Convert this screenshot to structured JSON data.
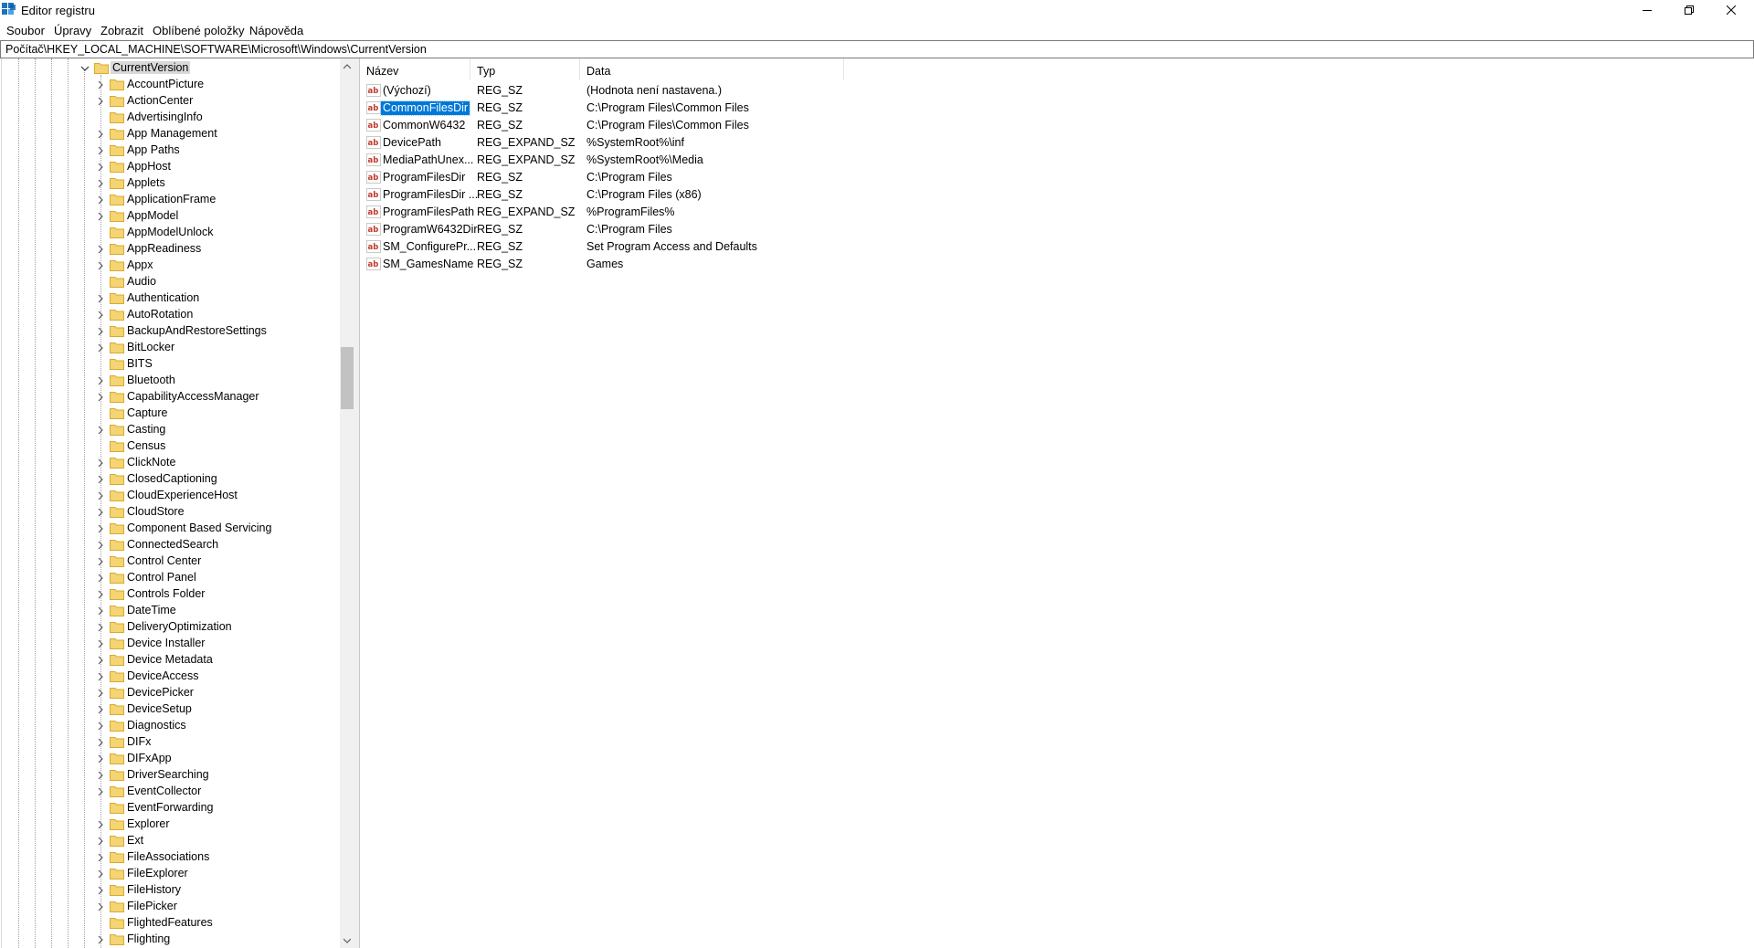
{
  "window": {
    "title": "Editor registru"
  },
  "menu": [
    "Soubor",
    "Úpravy",
    "Zobrazit",
    "Oblíbené položky",
    "Nápověda"
  ],
  "address": "Počítač\\HKEY_LOCAL_MACHINE\\SOFTWARE\\Microsoft\\Windows\\CurrentVersion",
  "tree": {
    "selected": "CurrentVersion",
    "children": [
      {
        "label": "AccountPicture",
        "expandable": true
      },
      {
        "label": "ActionCenter",
        "expandable": true
      },
      {
        "label": "AdvertisingInfo",
        "expandable": false
      },
      {
        "label": "App Management",
        "expandable": true
      },
      {
        "label": "App Paths",
        "expandable": true
      },
      {
        "label": "AppHost",
        "expandable": true
      },
      {
        "label": "Applets",
        "expandable": true
      },
      {
        "label": "ApplicationFrame",
        "expandable": true
      },
      {
        "label": "AppModel",
        "expandable": true
      },
      {
        "label": "AppModelUnlock",
        "expandable": false
      },
      {
        "label": "AppReadiness",
        "expandable": true
      },
      {
        "label": "Appx",
        "expandable": true
      },
      {
        "label": "Audio",
        "expandable": false
      },
      {
        "label": "Authentication",
        "expandable": true
      },
      {
        "label": "AutoRotation",
        "expandable": true
      },
      {
        "label": "BackupAndRestoreSettings",
        "expandable": true
      },
      {
        "label": "BitLocker",
        "expandable": true
      },
      {
        "label": "BITS",
        "expandable": false
      },
      {
        "label": "Bluetooth",
        "expandable": true
      },
      {
        "label": "CapabilityAccessManager",
        "expandable": true
      },
      {
        "label": "Capture",
        "expandable": false
      },
      {
        "label": "Casting",
        "expandable": true
      },
      {
        "label": "Census",
        "expandable": false
      },
      {
        "label": "ClickNote",
        "expandable": true
      },
      {
        "label": "ClosedCaptioning",
        "expandable": true
      },
      {
        "label": "CloudExperienceHost",
        "expandable": true
      },
      {
        "label": "CloudStore",
        "expandable": true
      },
      {
        "label": "Component Based Servicing",
        "expandable": true
      },
      {
        "label": "ConnectedSearch",
        "expandable": true
      },
      {
        "label": "Control Center",
        "expandable": true
      },
      {
        "label": "Control Panel",
        "expandable": true
      },
      {
        "label": "Controls Folder",
        "expandable": true
      },
      {
        "label": "DateTime",
        "expandable": true
      },
      {
        "label": "DeliveryOptimization",
        "expandable": true
      },
      {
        "label": "Device Installer",
        "expandable": true
      },
      {
        "label": "Device Metadata",
        "expandable": true
      },
      {
        "label": "DeviceAccess",
        "expandable": true
      },
      {
        "label": "DevicePicker",
        "expandable": true
      },
      {
        "label": "DeviceSetup",
        "expandable": true
      },
      {
        "label": "Diagnostics",
        "expandable": true
      },
      {
        "label": "DIFx",
        "expandable": true
      },
      {
        "label": "DIFxApp",
        "expandable": true
      },
      {
        "label": "DriverSearching",
        "expandable": true
      },
      {
        "label": "EventCollector",
        "expandable": true
      },
      {
        "label": "EventForwarding",
        "expandable": false
      },
      {
        "label": "Explorer",
        "expandable": true
      },
      {
        "label": "Ext",
        "expandable": true
      },
      {
        "label": "FileAssociations",
        "expandable": true
      },
      {
        "label": "FileExplorer",
        "expandable": true
      },
      {
        "label": "FileHistory",
        "expandable": true
      },
      {
        "label": "FilePicker",
        "expandable": true
      },
      {
        "label": "FlightedFeatures",
        "expandable": false
      },
      {
        "label": "Flighting",
        "expandable": true
      }
    ]
  },
  "list": {
    "columns": {
      "name": "Název",
      "type": "Typ",
      "data": "Data"
    },
    "selected": "CommonFilesDir",
    "rows": [
      {
        "name": "(Výchozí)",
        "type": "REG_SZ",
        "data": "(Hodnota není nastavena.)"
      },
      {
        "name": "CommonFilesDir",
        "type": "REG_SZ",
        "data": "C:\\Program Files\\Common Files"
      },
      {
        "name": "CommonW6432",
        "type": "REG_SZ",
        "data": "C:\\Program Files\\Common Files"
      },
      {
        "name": "DevicePath",
        "type": "REG_EXPAND_SZ",
        "data": "%SystemRoot%\\inf"
      },
      {
        "name": "MediaPathUnex...",
        "type": "REG_EXPAND_SZ",
        "data": "%SystemRoot%\\Media"
      },
      {
        "name": "ProgramFilesDir",
        "type": "REG_SZ",
        "data": "C:\\Program Files"
      },
      {
        "name": "ProgramFilesDir ...",
        "type": "REG_SZ",
        "data": "C:\\Program Files (x86)"
      },
      {
        "name": "ProgramFilesPath",
        "type": "REG_EXPAND_SZ",
        "data": "%ProgramFiles%"
      },
      {
        "name": "ProgramW6432Dir",
        "type": "REG_SZ",
        "data": "C:\\Program Files"
      },
      {
        "name": "SM_ConfigurePr...",
        "type": "REG_SZ",
        "data": "Set Program Access and Defaults"
      },
      {
        "name": "SM_GamesName",
        "type": "REG_SZ",
        "data": "Games"
      }
    ]
  },
  "icons": {
    "app": "registry-editor-icon",
    "folder": "folder-icon",
    "value": "string-value-icon",
    "folder_color": "#f4d473",
    "accent": "#0078d7"
  }
}
